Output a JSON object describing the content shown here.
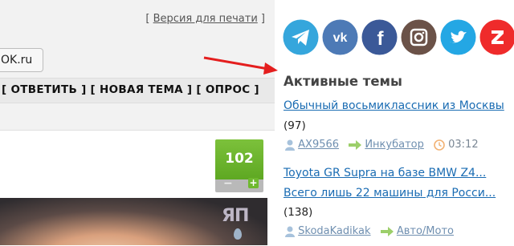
{
  "topbar": {
    "print_open": "[ ",
    "print_link": "Версия для печати",
    "print_close": " ]"
  },
  "ok_button": {
    "label": "OK.ru"
  },
  "actions": {
    "label": "[ ОТВЕТИТЬ ] [ НОВАЯ ТЕМА ] [ ОПРОС ]"
  },
  "rating": {
    "value": "102",
    "minus": "−",
    "plus": "+"
  },
  "photo": {
    "logo_text": "ЯП"
  },
  "social": [
    {
      "icon": "telegram-icon",
      "color": "#35a6dc"
    },
    {
      "icon": "vk-icon",
      "color": "#4d7ab6"
    },
    {
      "icon": "facebook-icon",
      "color": "#3b5998"
    },
    {
      "icon": "instagram-icon",
      "color": "#6b5248"
    },
    {
      "icon": "twitter-icon",
      "color": "#24a7e4"
    },
    {
      "icon": "zen-icon",
      "color": "#ef2b2b"
    }
  ],
  "active": {
    "title": "Активные темы",
    "topics": [
      {
        "title_lines": [
          "Обычный восьмиклассник из Москвы"
        ],
        "count": "(97)",
        "user": "AX9566",
        "forum": "Инкубатор",
        "time": "03:12"
      },
      {
        "title_lines": [
          "Toyota GR Supra на базе BMW Z4...",
          "Всего лишь 22 машины для Росси..."
        ],
        "count": "(138)",
        "user": "SkodaKadikak",
        "forum": "Авто/Мото"
      }
    ]
  }
}
